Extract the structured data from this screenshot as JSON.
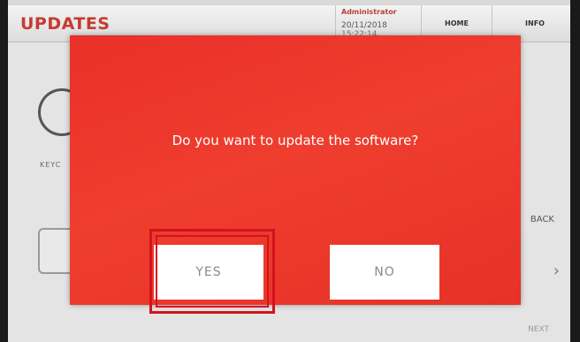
{
  "header": {
    "title": "UPDATES",
    "user": "Administrator",
    "date": "20/11/2018",
    "time": "15:22:14",
    "nav_home": "HOME",
    "nav_info": "INFO"
  },
  "background": {
    "key_label": "KEYC",
    "back_label": "BACK",
    "next_label": "NEXT"
  },
  "dialog": {
    "question": "Do you want to update the software?",
    "yes_label": "YES",
    "no_label": "NO"
  },
  "colors": {
    "dialog_red": "#ef3d2e",
    "brand_red": "#c73a30",
    "highlight_red": "#d4121e"
  }
}
